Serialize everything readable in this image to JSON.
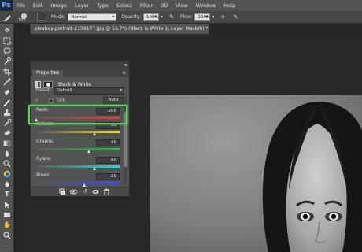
{
  "app": {
    "logo": "Ps"
  },
  "menu": [
    "File",
    "Edit",
    "Image",
    "Layer",
    "Type",
    "Select",
    "Filter",
    "3D",
    "View",
    "Window",
    "Help"
  ],
  "options_bar": {
    "brush_size": "700",
    "mode_label": "Mode:",
    "mode_value": "Normal",
    "opacity_label": "Opacity:",
    "opacity_value": "100%",
    "flow_label": "Flow:",
    "flow_value": "100%"
  },
  "document": {
    "tab_title": "pixabay-portrait-2159177.jpg @ 16.7% (Black & White 1, Layer Mask/8) *",
    "close_glyph": "×"
  },
  "panel": {
    "collapse_glyph": "◂◂",
    "tab_label": "Properties",
    "menu_glyph": "≡",
    "adjustment_title": "Black & White",
    "preset_label": "Preset:",
    "preset_value": "Default",
    "tint_label": "Tint",
    "tint_checked": false,
    "auto_label": "Auto",
    "sliders": [
      {
        "label": "Reds:",
        "value": "-200",
        "percent": 0.0,
        "gradient": [
          "#5a5a5a",
          "#ff3030"
        ]
      },
      {
        "label": "Yellows:",
        "value": "60",
        "percent": 0.7,
        "gradient": [
          "#5a5a5a",
          "#f0e020"
        ]
      },
      {
        "label": "Greens:",
        "value": "40",
        "percent": 0.64,
        "gradient": [
          "#5a5a5a",
          "#20c040"
        ]
      },
      {
        "label": "Cyans:",
        "value": "60",
        "percent": 0.7,
        "gradient": [
          "#5a5a5a",
          "#20d8e0"
        ]
      },
      {
        "label": "Blues:",
        "value": "20",
        "percent": 0.58,
        "gradient": [
          "#5a5a5a",
          "#3050ff"
        ]
      }
    ],
    "footer_icons": [
      "clip-to-layer-icon",
      "eye-icon",
      "undo-icon",
      "visibility-toggle-icon",
      "trash-icon"
    ]
  },
  "colors": {
    "highlight": "#5ed45c",
    "panel_bg": "#535353",
    "ui_dark": "#262626"
  }
}
